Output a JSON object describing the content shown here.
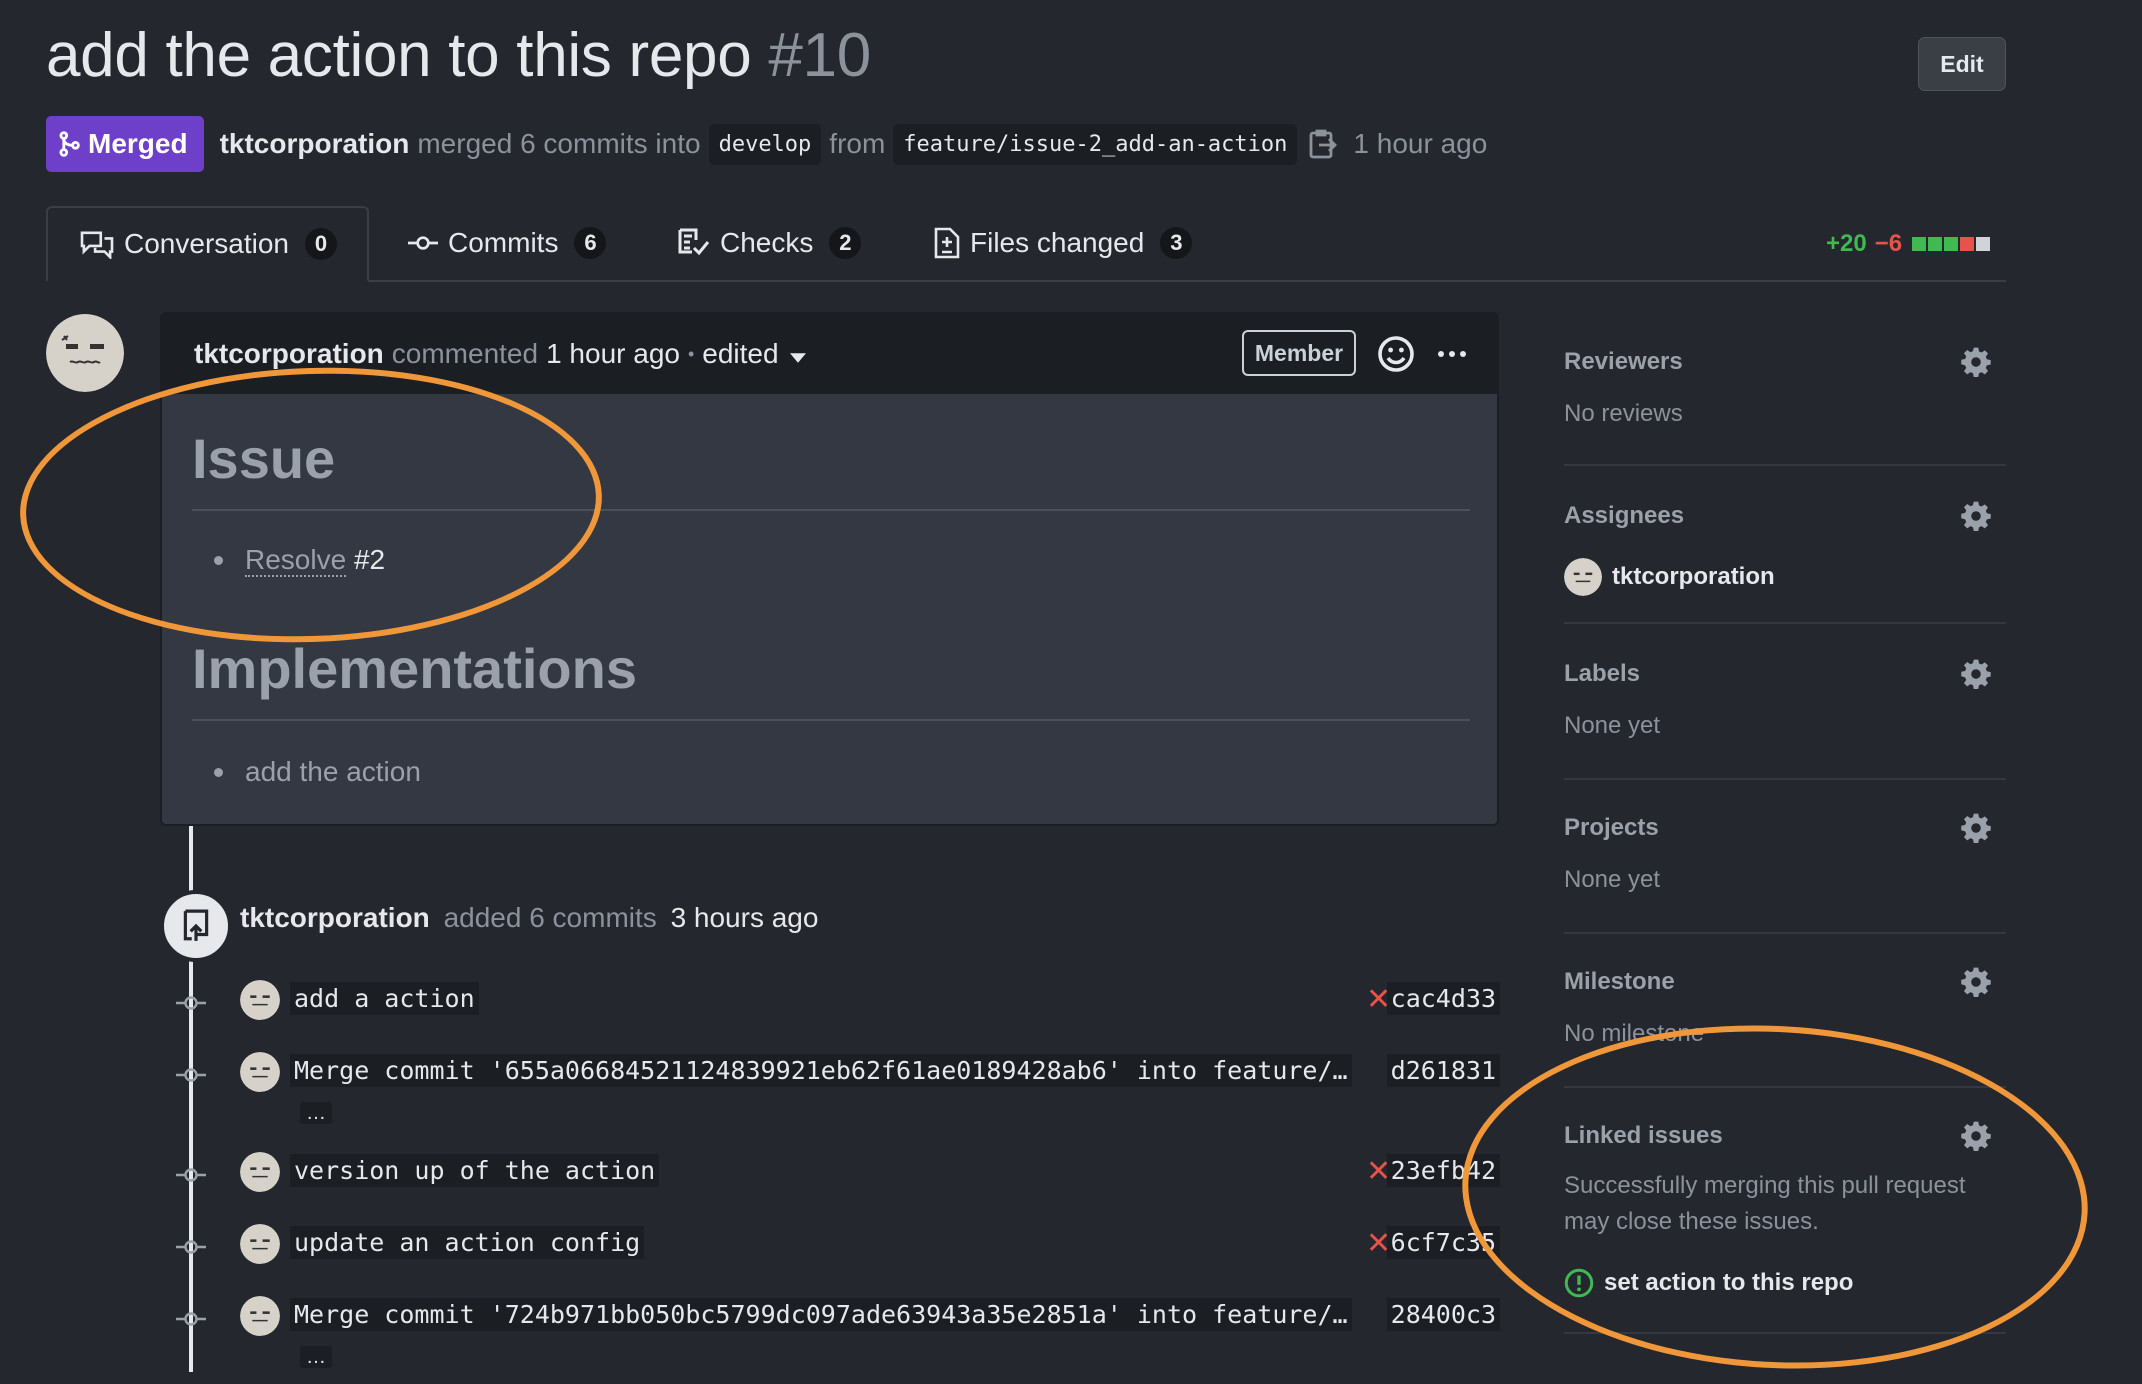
{
  "pr": {
    "title": "add the action to this repo",
    "number": "#10",
    "edit_label": "Edit",
    "state_label": "Merged",
    "author": "tktcorporation",
    "merged_text": "merged 6 commits into",
    "base_branch": "develop",
    "from_text": "from",
    "head_branch": "feature/issue-2_add-an-action",
    "time": "1 hour ago"
  },
  "tabs": [
    {
      "label": "Conversation",
      "count": "0",
      "icon": "comment-discussion-icon"
    },
    {
      "label": "Commits",
      "count": "6",
      "icon": "git-commit-icon"
    },
    {
      "label": "Checks",
      "count": "2",
      "icon": "checklist-icon"
    },
    {
      "label": "Files changed",
      "count": "3",
      "icon": "file-diff-icon"
    }
  ],
  "diffstat": {
    "additions": "+20",
    "deletions": "−6",
    "blocks": [
      "add",
      "add",
      "add",
      "del",
      "neutral"
    ]
  },
  "comment": {
    "author": "tktcorporation",
    "action": "commented",
    "time": "1 hour ago",
    "separator": "•",
    "edited_label": "edited",
    "role_badge": "Member",
    "body": {
      "heading1": "Issue",
      "item1_link": "Resolve",
      "item1_ref": "#2",
      "heading2": "Implementations",
      "item2": "add the action"
    }
  },
  "event": {
    "author": "tktcorporation",
    "text": "added 6 commits",
    "time": "3 hours ago"
  },
  "commits": [
    {
      "message": "add a action",
      "sha": "cac4d33",
      "status": "✕",
      "ellipsis": ""
    },
    {
      "message": "Merge commit '655a06684521124839921eb62f61ae0189428ab6' into feature/…",
      "sha": "d261831",
      "status": "",
      "ellipsis": "…"
    },
    {
      "message": "version up of the action",
      "sha": "23efb42",
      "status": "✕",
      "ellipsis": ""
    },
    {
      "message": "update an action config",
      "sha": "6cf7c35",
      "status": "✕",
      "ellipsis": ""
    },
    {
      "message": "Merge commit '724b971bb050bc5799dc097ade63943a35e2851a' into feature/…",
      "sha": "28400c3",
      "status": "",
      "ellipsis": "…"
    }
  ],
  "sidebar": {
    "reviewers": {
      "heading": "Reviewers",
      "value": "No reviews"
    },
    "assignees": {
      "heading": "Assignees",
      "value": "tktcorporation"
    },
    "labels": {
      "heading": "Labels",
      "value": "None yet"
    },
    "projects": {
      "heading": "Projects",
      "value": "None yet"
    },
    "milestone": {
      "heading": "Milestone",
      "value": "No milestone"
    },
    "linked_issues": {
      "heading": "Linked issues",
      "description_line1": "Successfully merging this pull request",
      "description_line2": "may close these issues.",
      "issue": "set action to this repo"
    }
  },
  "colors": {
    "background": "#24272e",
    "merged": "#6e40c9",
    "additions": "#3fb950",
    "deletions": "#e5534b",
    "annotation": "#f0973a"
  }
}
